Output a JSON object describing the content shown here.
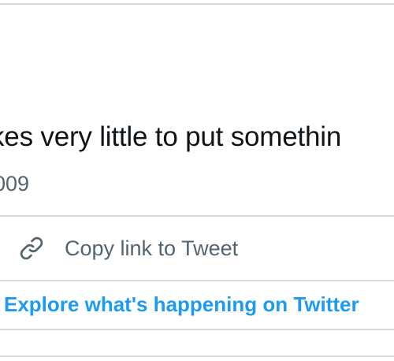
{
  "tweet": {
    "text": "kes very little to put somethin",
    "date": "009"
  },
  "actions": {
    "copy_link_label": "Copy link to Tweet",
    "copy_link_icon": "link-icon"
  },
  "footer": {
    "explore_label": "Explore what's happening on Twitter"
  },
  "colors": {
    "text_primary": "#0f1419",
    "text_secondary": "#536471",
    "accent": "#1d9bf0",
    "divider": "#cfd9de"
  }
}
